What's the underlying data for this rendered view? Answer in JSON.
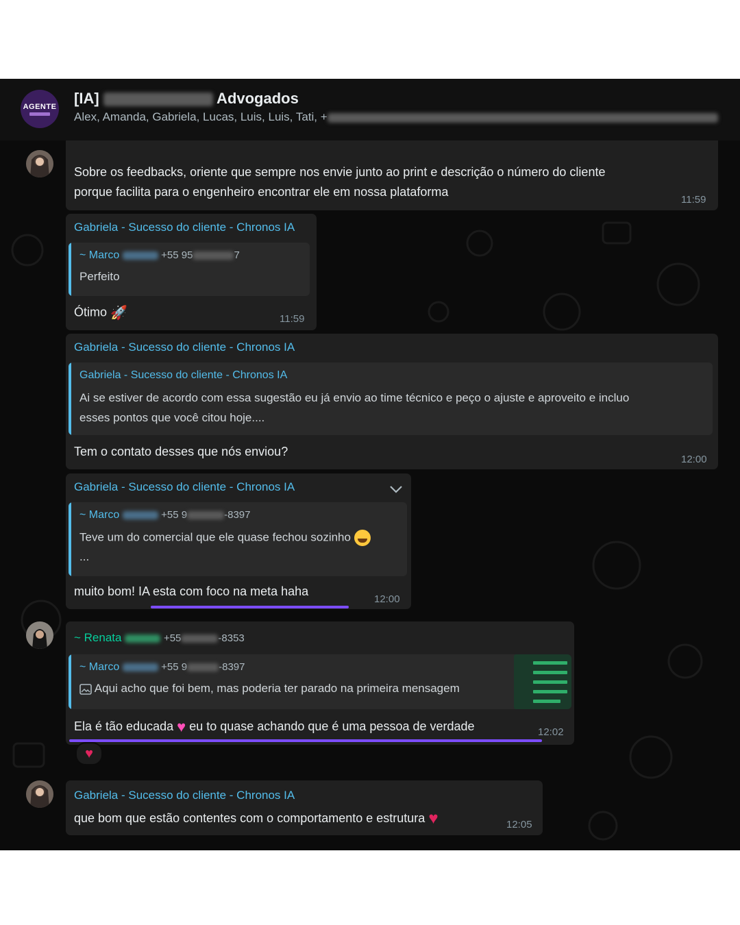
{
  "header": {
    "title_prefix": "[IA] ",
    "title_suffix": " Advogados",
    "members": "Alex, Amanda, Gabriela, Lucas, Luis, Luis, Tati, +",
    "avatar_text": "AGENTE"
  },
  "messages": {
    "m1": {
      "text_line1": "Sobre os feedbacks, oriente que sempre nos envie junto ao print e descrição o número do cliente",
      "text_line2": "porque facilita para o engenheiro encontrar ele em nossa plataforma",
      "time": "11:59"
    },
    "m2": {
      "sender": "Gabriela - Sucesso do cliente - Chronos IA",
      "quote_name": "~ Marco",
      "quote_number_a": "+55 95",
      "quote_number_b": "7",
      "quote_text": "Perfeito",
      "text": "Ótimo",
      "time": "11:59"
    },
    "m3": {
      "sender": "Gabriela - Sucesso do cliente - Chronos IA",
      "quote_name": "Gabriela - Sucesso do cliente - Chronos IA",
      "quote_line1": "Ai se estiver de acordo com essa sugestão eu já envio ao time técnico e peço o ajuste e aproveito e incluo",
      "quote_line2": "esses pontos que você citou hoje....",
      "text": "Tem o contato desses que nós enviou?",
      "time": "12:00"
    },
    "m4": {
      "sender": "Gabriela - Sucesso do cliente - Chronos IA",
      "quote_name": "~ Marco",
      "quote_number_a": "+55 9",
      "quote_number_b": "-8397",
      "quote_text": "Teve um do comercial que ele quase fechou sozinho",
      "quote_more": "...",
      "text": "muito bom! IA esta com foco na meta haha",
      "time": "12:00"
    },
    "m5": {
      "sender": "~ Renata",
      "sender_number_a": "+55",
      "sender_number_b": "-8353",
      "quote_name": "~ Marco",
      "quote_number_a": "+55 9",
      "quote_number_b": "-8397",
      "quote_text": "Aqui acho que foi bem, mas poderia ter parado na primeira mensagem",
      "text_a": "Ela é tão educada",
      "text_b": "eu to quase achando que é uma pessoa de verdade",
      "time": "12:02"
    },
    "m6": {
      "sender": "Gabriela - Sucesso do cliente - Chronos IA",
      "text": "que bom que estão contentes com o comportamento e estrutura",
      "time": "12:05"
    }
  },
  "colors": {
    "accent_underline": "#7c4dff",
    "sender_blue": "#53bdeb",
    "sender_green": "#06cf9c",
    "bubble": "#202020",
    "background": "#0b0b0b"
  },
  "icons": [
    "chevron-down-icon",
    "image-icon",
    "heart-icon",
    "rocket-icon",
    "laughing-face-icon"
  ]
}
